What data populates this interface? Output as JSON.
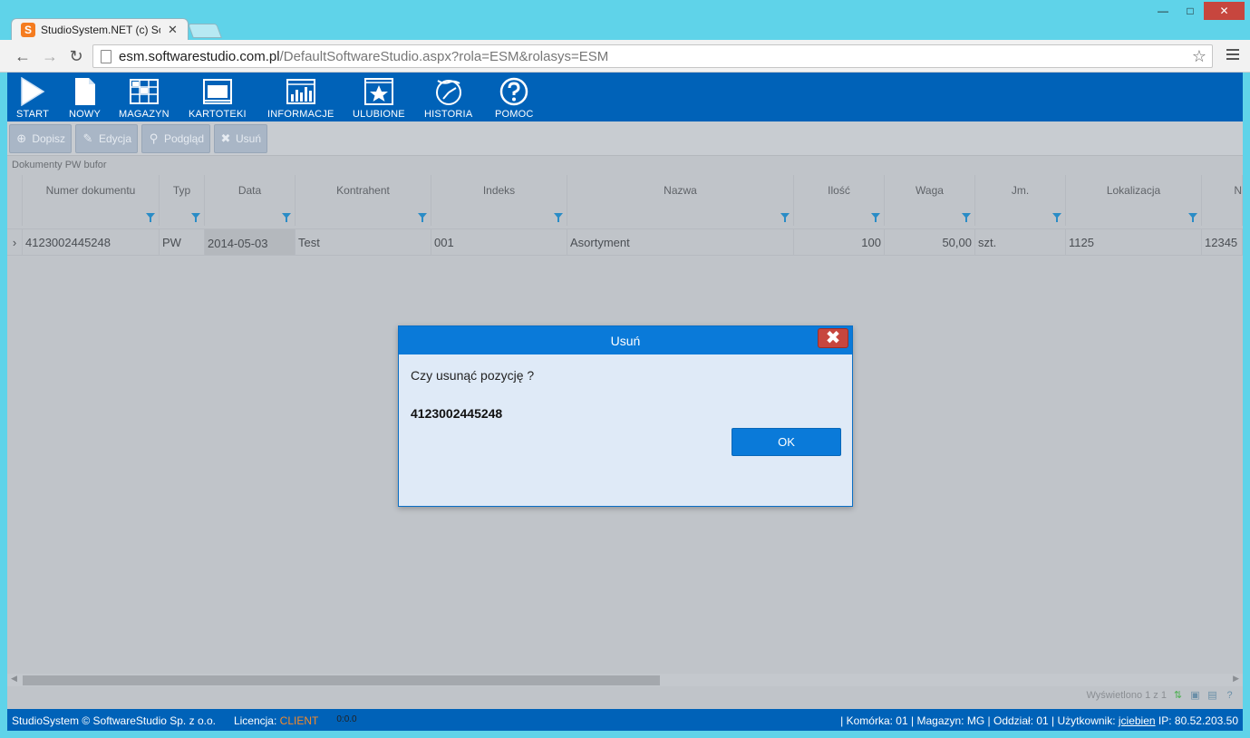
{
  "browser": {
    "tab_title": "StudioSystem.NET (c) Soft",
    "tab_close": "✕",
    "favicon_letter": "S",
    "url_host": "esm.softwarestudio.com.pl",
    "url_path": "/DefaultSoftwareStudio.aspx?rola=ESM&rolasys=ESM",
    "back_glyph": "←",
    "forward_glyph": "→",
    "reload_glyph": "↻",
    "star_glyph": "☆",
    "minimize_glyph": "—",
    "maximize_glyph": "□",
    "close_glyph": "✕"
  },
  "nav": [
    {
      "label": "START",
      "icon": "play-icon"
    },
    {
      "label": "NOWY",
      "icon": "document-icon"
    },
    {
      "label": "MAGAZYN",
      "icon": "warehouse-grid-icon"
    },
    {
      "label": "KARTOTEKI",
      "icon": "window-icon"
    },
    {
      "label": "INFORMACJE",
      "icon": "bar-chart-icon"
    },
    {
      "label": "ULUBIONE",
      "icon": "star-icon"
    },
    {
      "label": "HISTORIA",
      "icon": "history-icon"
    },
    {
      "label": "POMOC",
      "icon": "help-icon"
    }
  ],
  "actions": [
    {
      "label": "Dopisz",
      "icon": "plus-circle-icon",
      "glyph": "⊕"
    },
    {
      "label": "Edycja",
      "icon": "edit-icon",
      "glyph": "✎"
    },
    {
      "label": "Podgląd",
      "icon": "magnifier-icon",
      "glyph": "⚲"
    },
    {
      "label": "Usuń",
      "icon": "delete-x-icon",
      "glyph": "✖"
    }
  ],
  "grid": {
    "title": "Dokumenty PW bufor",
    "columns": [
      "Numer dokumentu",
      "Typ",
      "Data",
      "Kontrahent",
      "Indeks",
      "Nazwa",
      "Ilość",
      "Waga",
      "Jm.",
      "Lokalizacja",
      "N"
    ],
    "rows": [
      {
        "indicator": "›",
        "cells": [
          "4123002445248",
          "PW",
          "2014-05-03",
          "Test",
          "001",
          "Asortyment",
          "100",
          "50,00",
          "szt.",
          "1125",
          "12345"
        ]
      }
    ]
  },
  "pager": {
    "text": "Wyświetlono 1 z 1"
  },
  "status": {
    "copyright": "StudioSystem © SoftwareStudio Sp. z o.o.",
    "license_label": "Licencja:",
    "license_value": "CLIENT",
    "timer": "0:0.0",
    "komorka": "Komórka: 01",
    "magazyn": "Magazyn: MG",
    "oddzial": "Oddział: 01",
    "uzytkownik_label": "Użytkownik:",
    "uzytkownik": "jciebien",
    "ip": "IP: 80.52.203.50",
    "separator": "|"
  },
  "dialog": {
    "title": "Usuń",
    "close_glyph": "✖",
    "message": "Czy usunąć pozycję ?",
    "document_number": "4123002445248",
    "ok_label": "OK"
  },
  "colors": {
    "nav_bg": "#0062b8",
    "overlay_bg": "#c0c4c9",
    "dialog_header": "#0a7ad9",
    "close_red": "#c7463e",
    "license_orange": "#f58a2a"
  }
}
